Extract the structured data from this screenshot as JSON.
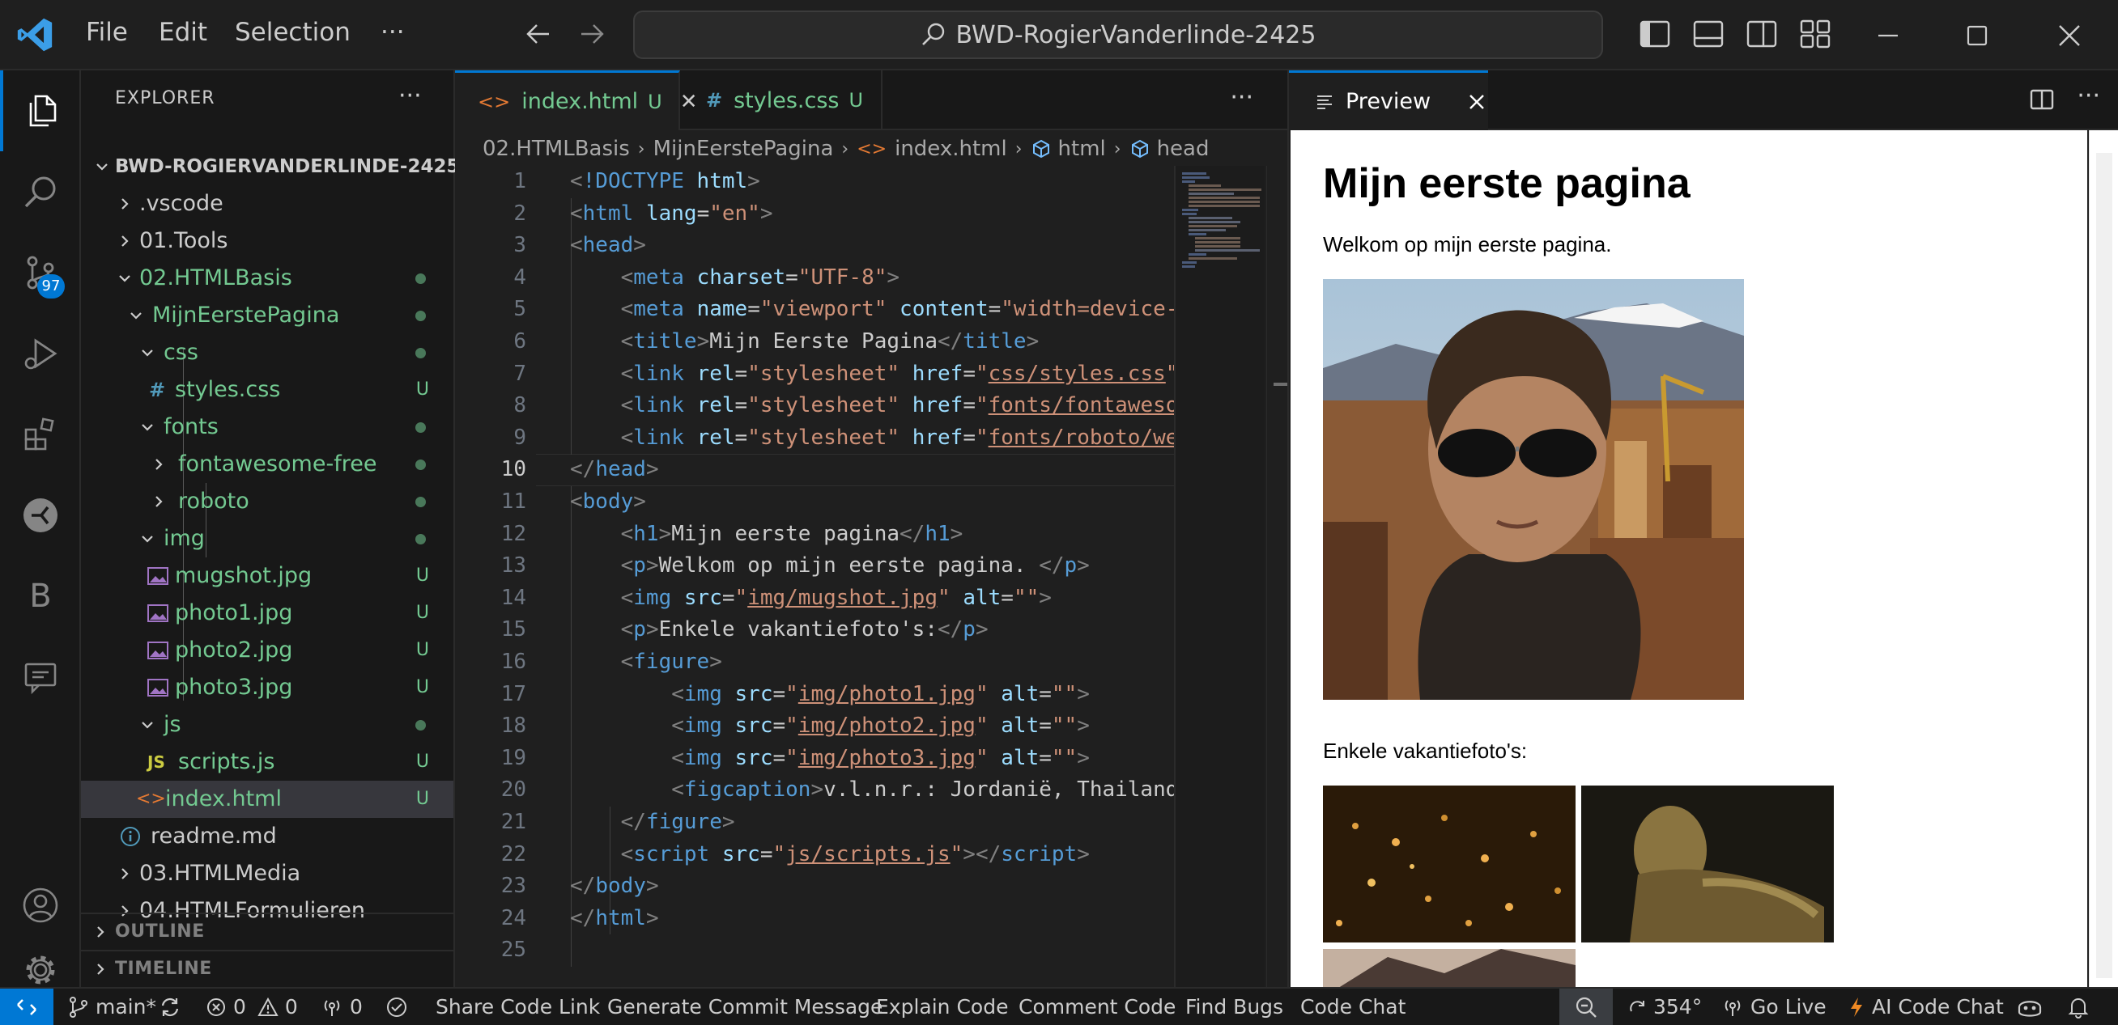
{
  "titlebar": {
    "menu": [
      "File",
      "Edit",
      "Selection"
    ],
    "more": "···",
    "search": "BWD-RogierVanderlinde-2425"
  },
  "activitybar": {
    "scm_badge": "97",
    "extra_letter": "B"
  },
  "explorer": {
    "header": "EXPLORER",
    "more": "···",
    "root": "BWD-ROGIERVANDERLINDE-2425",
    "items": [
      {
        "label": ".vscode",
        "kind": "folder"
      },
      {
        "label": "01.Tools",
        "kind": "folder"
      },
      {
        "label": "02.HTMLBasis",
        "kind": "folder"
      },
      {
        "label": "MijnEerstePagina",
        "kind": "folder"
      },
      {
        "label": "css",
        "kind": "folder"
      },
      {
        "label": "styles.css",
        "kind": "file",
        "icon": "#",
        "status": "U"
      },
      {
        "label": "fonts",
        "kind": "folder"
      },
      {
        "label": "fontawesome-free",
        "kind": "folder"
      },
      {
        "label": "roboto",
        "kind": "folder"
      },
      {
        "label": "img",
        "kind": "folder"
      },
      {
        "label": "mugshot.jpg",
        "kind": "file",
        "status": "U"
      },
      {
        "label": "photo1.jpg",
        "kind": "file",
        "status": "U"
      },
      {
        "label": "photo2.jpg",
        "kind": "file",
        "status": "U"
      },
      {
        "label": "photo3.jpg",
        "kind": "file",
        "status": "U"
      },
      {
        "label": "js",
        "kind": "folder"
      },
      {
        "label": "scripts.js",
        "kind": "file",
        "icon": "JS",
        "status": "U"
      },
      {
        "label": "index.html",
        "kind": "file",
        "icon": "<>",
        "status": "U"
      },
      {
        "label": "readme.md",
        "kind": "file",
        "icon": "i"
      },
      {
        "label": "03.HTMLMedia",
        "kind": "folder"
      },
      {
        "label": "04.HTMLFormulieren",
        "kind": "folder"
      }
    ],
    "outline": "OUTLINE",
    "timeline": "TIMELINE"
  },
  "editor": {
    "tabs": [
      {
        "label": "index.html",
        "status": "U",
        "icon": "<>"
      },
      {
        "label": "styles.css",
        "status": "U",
        "icon": "#"
      }
    ],
    "more": "···",
    "breadcrumb": [
      "02.HTMLBasis",
      "MijnEerstePagina",
      "index.html",
      "html",
      "head"
    ],
    "current_line": 10,
    "line_numbers": [
      "1",
      "2",
      "3",
      "4",
      "5",
      "6",
      "7",
      "8",
      "9",
      "10",
      "11",
      "12",
      "13",
      "14",
      "15",
      "16",
      "17",
      "18",
      "19",
      "20",
      "21",
      "22",
      "23",
      "24",
      "25"
    ]
  },
  "preview": {
    "tab_label": "Preview",
    "page": {
      "heading": "Mijn eerste pagina",
      "intro": "Welkom op mijn eerste pagina.",
      "vacation": "Enkele vakantiefoto's:"
    }
  },
  "statusbar": {
    "branch": "main*",
    "errors": "0",
    "warnings": "0",
    "ports": "0",
    "items": [
      "Share Code Link",
      "Generate Commit Message",
      "Explain Code",
      "Comment Code",
      "Find Bugs",
      "Code Chat"
    ],
    "temp": "354°",
    "golive": "Go Live",
    "ai": "AI Code Chat"
  },
  "colors": {
    "accent": "#0078d4",
    "untracked": "#73c991",
    "tag": "#569cd6",
    "attr": "#9cdcfe",
    "string": "#ce9178"
  }
}
